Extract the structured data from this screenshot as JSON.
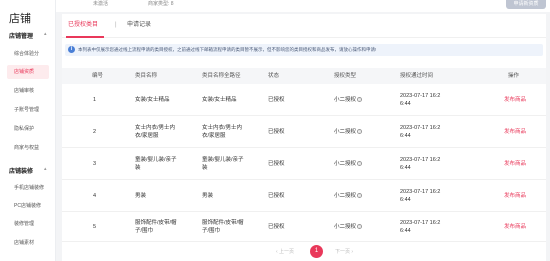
{
  "sidebar": {
    "store_title": "店铺",
    "sections": [
      {
        "title": "店铺管理",
        "chevron": "▴",
        "items": [
          "综合体验分",
          "店铺资质",
          "店铺审核",
          "子账号管理",
          "隐私保护",
          "商家与权益"
        ]
      },
      {
        "title": "店铺装修",
        "chevron": "▴",
        "items": [
          "手机店铺装修",
          "PC店铺装修",
          "装修管理",
          "店铺素材"
        ]
      }
    ]
  },
  "topbar": {
    "meta1": "未激活",
    "meta2": "商家类型: 8",
    "cert_button": "申请新资质"
  },
  "tabs": [
    {
      "label": "已授权类目"
    },
    {
      "label": "申请记录"
    }
  ],
  "tab_separator": "|",
  "notice": {
    "icon": "i",
    "text": "本列表中仅展示您通过线上流程申请的类目授权，之前通过线下邮箱流程申请的类目暂不展示，但不影响您的类目授权和商品发布，请放心操作和申请!"
  },
  "table": {
    "columns": [
      "编号",
      "类目名称",
      "类目名称全路径",
      "状态",
      "授权类型",
      "授权通过时间",
      "操作"
    ],
    "rows": [
      {
        "id": "1",
        "name": [
          "女装/女士精品"
        ],
        "path": [
          "女装/女士精品"
        ],
        "status": "已授权",
        "type": "小二授权",
        "time": [
          "2023-07-17 16:2",
          "6:44"
        ],
        "action": "发布商品"
      },
      {
        "id": "2",
        "name": [
          "女士内衣/男士内",
          "衣/家居服"
        ],
        "path": [
          "女士内衣/男士内",
          "衣/家居服"
        ],
        "status": "已授权",
        "type": "小二授权",
        "time": [
          "2023-07-17 16:2",
          "6:44"
        ],
        "action": "发布商品"
      },
      {
        "id": "3",
        "name": [
          "童装/婴儿装/亲子",
          "装"
        ],
        "path": [
          "童装/婴儿装/亲子",
          "装"
        ],
        "status": "已授权",
        "type": "小二授权",
        "time": [
          "2023-07-17 16:2",
          "6:44"
        ],
        "action": "发布商品"
      },
      {
        "id": "4",
        "name": [
          "男装"
        ],
        "path": [
          "男装"
        ],
        "status": "已授权",
        "type": "小二授权",
        "time": [
          "2023-07-17 16:2",
          "6:44"
        ],
        "action": "发布商品"
      },
      {
        "id": "5",
        "name": [
          "服饰配件/皮带/帽",
          "子/围巾"
        ],
        "path": [
          "服饰配件/皮带/帽",
          "子/围巾"
        ],
        "status": "已授权",
        "type": "小二授权",
        "time": [
          "2023-07-17 16:2",
          "6:44"
        ],
        "action": "发布商品"
      }
    ]
  },
  "pagination": {
    "prev": "‹ 上一页",
    "current": "1",
    "next": "下一页 ›"
  },
  "colors": {
    "accent": "#e9385a",
    "notice_bg": "#eef3fb",
    "info_icon": "#4a7fd6"
  }
}
